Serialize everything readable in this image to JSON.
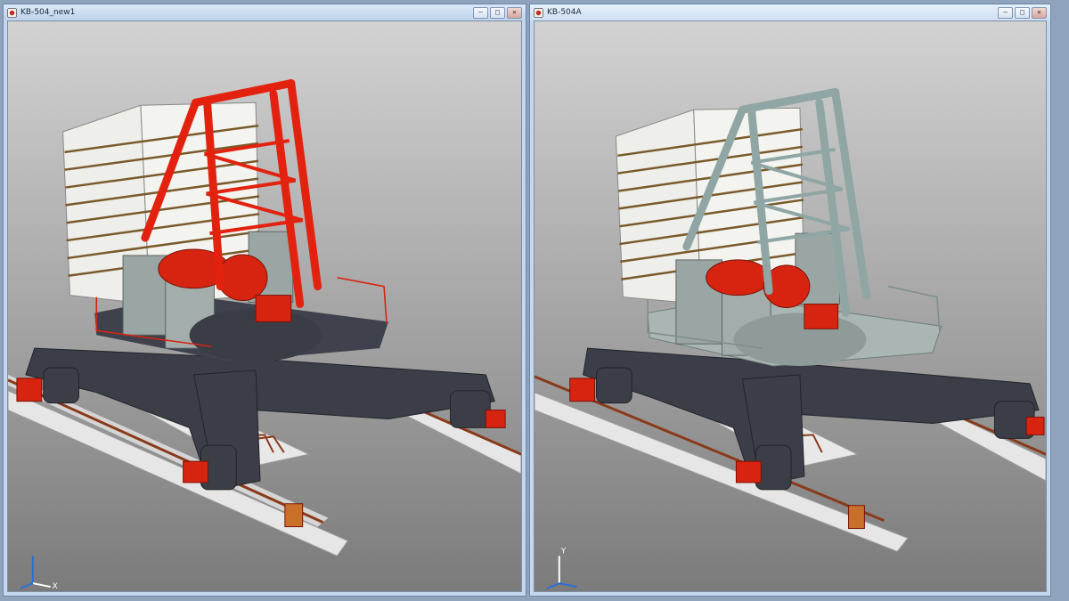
{
  "windows": [
    {
      "title": "KB-504_new1",
      "accent": "#e2220e",
      "active": false
    },
    {
      "title": "KB-504A",
      "accent": "#8fa6a4",
      "active": true
    }
  ],
  "controls": {
    "minimize": "–",
    "restore": "□",
    "close": "✕"
  },
  "triad": {
    "y_label": "Y",
    "x_label": "X"
  },
  "colors": {
    "bg_top": "#d2d2d2",
    "bg_bottom": "#7b7b7b",
    "undercarriage": "#3b3d47",
    "machinery_gray": "#9aa6a4",
    "counterweight": "#eeeeea",
    "counterweight_band": "#7a5a2a",
    "rail": "#e4e4e4",
    "rail_rust": "#8a3a1a",
    "motor_red": "#d62410"
  }
}
